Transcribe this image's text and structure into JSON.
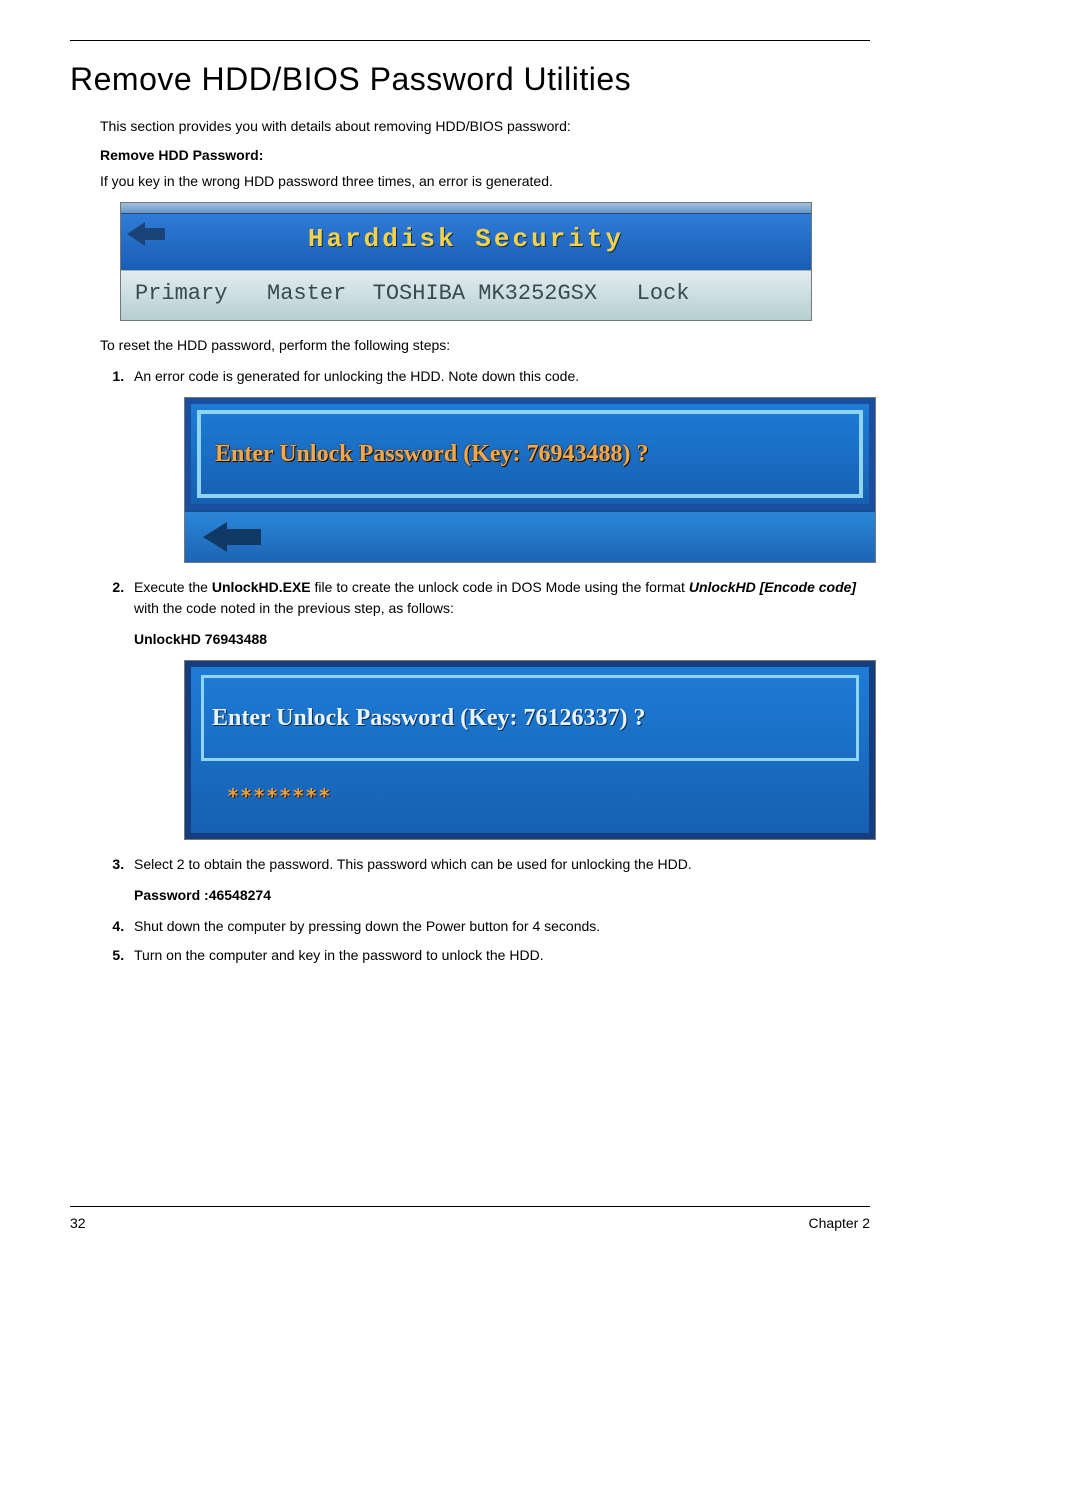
{
  "title": "Remove HDD/BIOS Password Utilities",
  "intro": "This section provides you with details about removing HDD/BIOS password:",
  "remove_heading": "Remove HDD Password:",
  "error_text": "If you key in the wrong HDD password three times, an error is generated.",
  "scr1": {
    "title": "Harddisk Security",
    "row": "Primary   Master  TOSHIBA MK3252GSX   Lock"
  },
  "reset_intro": "To reset the HDD password, perform the following steps:",
  "step1": "An error code is generated for unlocking the HDD. Note down this code.",
  "scr2_text": "Enter Unlock Password (Key: 76943488) ?",
  "step2_a": "Execute the ",
  "step2_file": "UnlockHD.EXE",
  "step2_b": " file to create the unlock code in DOS Mode using the format ",
  "step2_cmd": "UnlockHD [Encode code]",
  "step2_c": " with the code noted in the previous step, as follows:",
  "unlock_cmd": "UnlockHD  76943488",
  "scr3_text": "Enter Unlock Password (Key: 76126337) ?",
  "scr3_stars": "********",
  "step3": "Select 2 to obtain the password. This password which can be used for unlocking the HDD.",
  "password_line": "Password :46548274",
  "step4": "Shut down the computer by pressing down the Power button for 4 seconds.",
  "step5": "Turn on the computer and key in the password to unlock the HDD.",
  "footer_left": "32",
  "footer_right": "Chapter 2"
}
